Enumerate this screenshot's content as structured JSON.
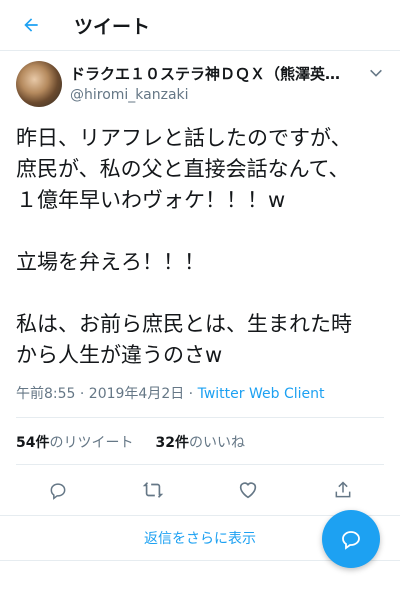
{
  "header": {
    "title": "ツイート"
  },
  "author": {
    "name": "ドラクエ１０ステラ神ＤＱＸ（熊澤英…",
    "handle": "@hiromi_kanzaki"
  },
  "tweet": {
    "lines1": [
      "昨日、リアフレと話したのですが、",
      "庶民が、私の父と直接会話なんて、",
      "１億年早いわヴォケ！！！w"
    ],
    "lines2": [
      "立場を弁えろ！！！"
    ],
    "lines3": [
      "私は、お前ら庶民とは、生まれた時",
      "から人生が違うのさw"
    ]
  },
  "meta": {
    "time": "午前8:55 · 2019年4月2日 · ",
    "source": "Twitter Web Client"
  },
  "stats": {
    "retweets_count": "54件",
    "retweets_label": "のリツイート",
    "likes_count": "32件",
    "likes_label": "のいいね"
  },
  "more_replies": "返信をさらに表示",
  "colors": {
    "accent": "#1da1f2",
    "muted": "#657786",
    "text": "#14171a"
  },
  "icons": {
    "back": "arrow-left-icon",
    "menu": "chevron-down-icon",
    "reply": "reply-icon",
    "retweet": "retweet-icon",
    "like": "heart-icon",
    "share": "share-icon",
    "compose": "compose-reply-icon"
  }
}
